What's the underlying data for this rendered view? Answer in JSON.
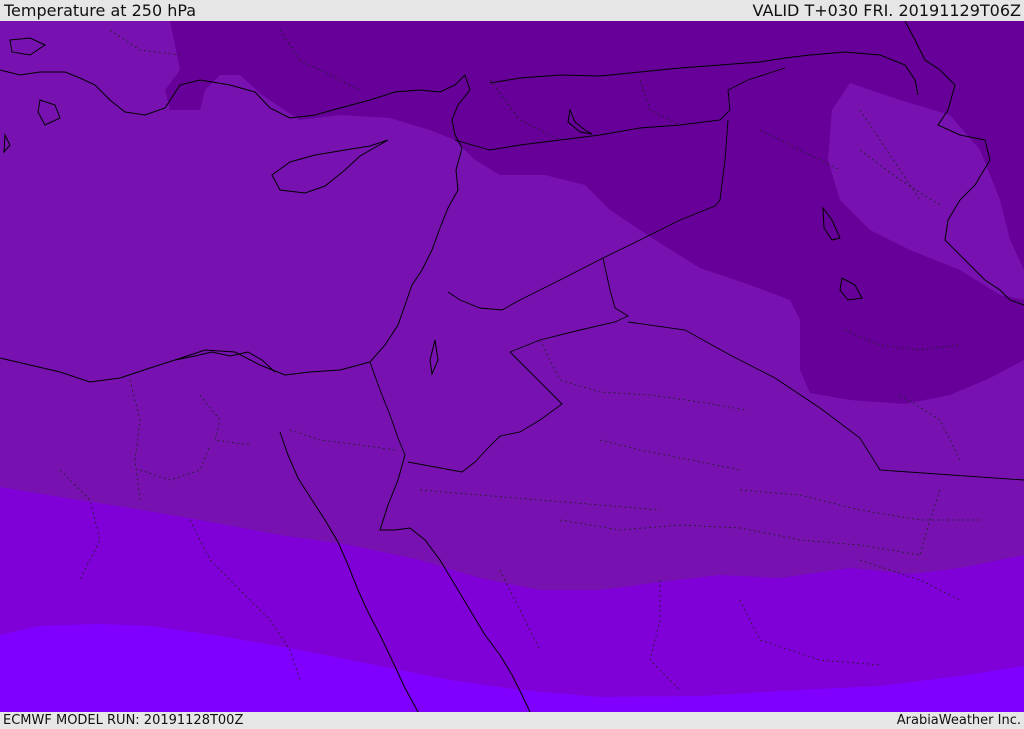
{
  "header": {
    "title": "Temperature at 250 hPa",
    "valid_time": "VALID T+030 FRI. 20191129T06Z"
  },
  "footer": {
    "model_run": "ECMWF MODEL RUN: 20191128T00Z",
    "credit": "ArabiaWeather Inc."
  },
  "map": {
    "field": "Temperature at 250 hPa",
    "colors": {
      "coldest_band": "#660099",
      "cold_band": "#7712b0",
      "mid_band": "#8000d8",
      "warm_band": "#7f00ff",
      "coastline": "#000000"
    }
  }
}
